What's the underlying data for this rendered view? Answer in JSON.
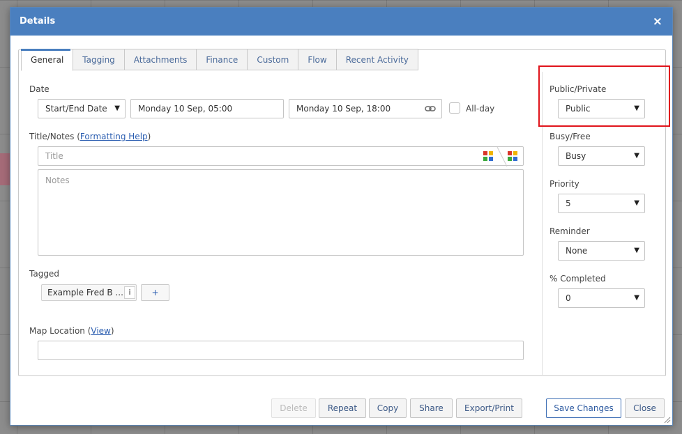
{
  "dialog": {
    "title": "Details",
    "close_icon": "×"
  },
  "tabs": [
    {
      "label": "General"
    },
    {
      "label": "Tagging"
    },
    {
      "label": "Attachments"
    },
    {
      "label": "Finance"
    },
    {
      "label": "Custom"
    },
    {
      "label": "Flow"
    },
    {
      "label": "Recent Activity"
    }
  ],
  "active_tab": "General",
  "date": {
    "label": "Date",
    "mode_selected": "Start/End Date",
    "start": "Monday 10 Sep, 05:00",
    "end": "Monday 10 Sep, 18:00",
    "allday_label": "All-day",
    "allday_checked": false
  },
  "notes": {
    "label_prefix": "Title/Notes (",
    "formatting_link": "Formatting Help",
    "label_suffix": ")",
    "title_placeholder": "Title",
    "notes_placeholder": "Notes"
  },
  "tagged": {
    "label": "Tagged",
    "chip": "Example Fred B ...",
    "chip_info": "i",
    "add": "+"
  },
  "map": {
    "label_prefix": "Map Location (",
    "view_link": "View",
    "label_suffix": ")",
    "value": ""
  },
  "side": {
    "public_private": {
      "label": "Public/Private",
      "value": "Public"
    },
    "busy_free": {
      "label": "Busy/Free",
      "value": "Busy"
    },
    "priority": {
      "label": "Priority",
      "value": "5"
    },
    "reminder": {
      "label": "Reminder",
      "value": "None"
    },
    "completed": {
      "label": "% Completed",
      "value": "0"
    }
  },
  "footer": {
    "delete": "Delete",
    "repeat": "Repeat",
    "copy": "Copy",
    "share": "Share",
    "export": "Export/Print",
    "save": "Save Changes",
    "close": "Close"
  },
  "icons": {
    "caret": "▼",
    "link_icon": "link-icon",
    "colorgrid_icon": "color-grid-icon"
  },
  "colors": {
    "header": "#4a7fbf",
    "highlight": "#e0141b",
    "grid_red": "#d9352a",
    "grid_yellow": "#f0b400",
    "grid_green": "#3aa83a",
    "grid_blue": "#2f6bd0"
  }
}
